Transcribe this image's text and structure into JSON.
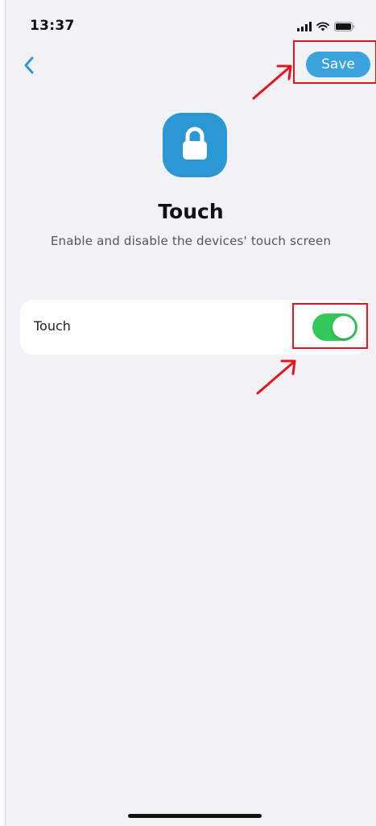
{
  "status_bar": {
    "time": "13:37",
    "icons": [
      "signal-icon",
      "wifi-icon",
      "battery-icon"
    ]
  },
  "nav": {
    "back_icon": "chevron-left-icon",
    "save_label": "Save"
  },
  "header": {
    "icon": "lock-icon",
    "title": "Touch",
    "subtitle": "Enable and disable the devices' touch screen"
  },
  "settings": {
    "touch": {
      "label": "Touch",
      "enabled": true
    }
  },
  "colors": {
    "accent": "#3aa3db",
    "icon_tile": "#2c98d3",
    "toggle_on": "#34c759",
    "background": "#f2f1f6",
    "annotation": "#e8141c"
  }
}
